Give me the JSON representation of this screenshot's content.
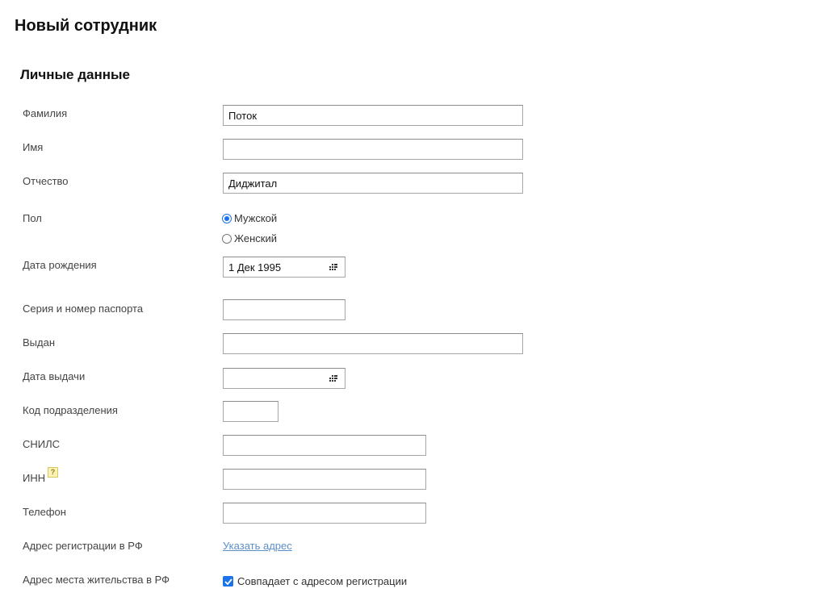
{
  "page": {
    "title": "Новый сотрудник"
  },
  "section": {
    "title": "Личные данные"
  },
  "fields": {
    "last_name": {
      "label": "Фамилия",
      "value": "Поток"
    },
    "first_name": {
      "label": "Имя",
      "value": ""
    },
    "middle_name": {
      "label": "Отчество",
      "value": "Диджитал"
    },
    "gender": {
      "label": "Пол",
      "options": [
        "Мужской",
        "Женский"
      ],
      "selected": "Мужской"
    },
    "birth_date": {
      "label": "Дата рождения",
      "value": "1 Дек 1995",
      "icon": "calendar-icon"
    },
    "passport": {
      "label": "Серия и номер паспорта",
      "value": ""
    },
    "issued_by": {
      "label": "Выдан",
      "value": ""
    },
    "issue_date": {
      "label": "Дата выдачи",
      "value": "",
      "icon": "calendar-icon"
    },
    "division_code": {
      "label": "Код подразделения",
      "value": ""
    },
    "snils": {
      "label": "СНИЛС",
      "value": ""
    },
    "inn": {
      "label": "ИНН",
      "help": "?",
      "value": ""
    },
    "phone": {
      "label": "Телефон",
      "value": ""
    },
    "reg_address": {
      "label": "Адрес регистрации в РФ",
      "link": "Указать адрес"
    },
    "residence_address": {
      "label": "Адрес места жительства в РФ",
      "checkbox_label": "Совпадает с адресом регистрации",
      "checked": true
    }
  },
  "colors": {
    "accent": "#1a73e8",
    "link": "#5b8fc7",
    "help_bg": "#fbf3b6"
  }
}
